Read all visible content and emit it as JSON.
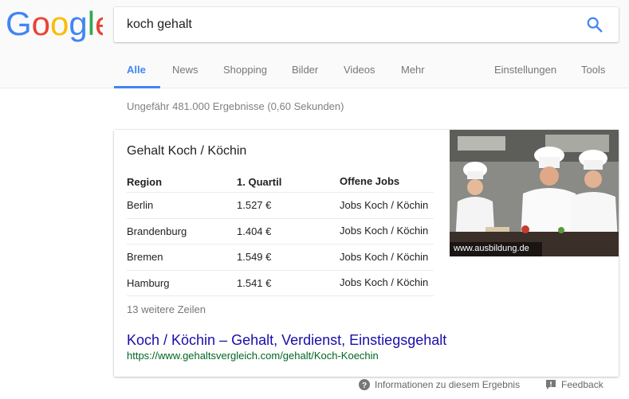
{
  "search": {
    "query": "koch gehalt"
  },
  "tabs": {
    "items": [
      {
        "label": "Alle",
        "active": true
      },
      {
        "label": "News"
      },
      {
        "label": "Shopping"
      },
      {
        "label": "Bilder"
      },
      {
        "label": "Videos"
      },
      {
        "label": "Mehr"
      }
    ],
    "settings": "Einstellungen",
    "tools": "Tools"
  },
  "stats": "Ungefähr 481.000 Ergebnisse (0,60 Sekunden)",
  "card": {
    "title": "Gehalt Koch / Köchin",
    "headers": [
      "Region",
      "1. Quartil",
      "Offene Jobs"
    ],
    "rows": [
      {
        "region": "Berlin",
        "quartil": "1.527 €",
        "jobs": "Jobs Koch / Köchin"
      },
      {
        "region": "Brandenburg",
        "quartil": "1.404 €",
        "jobs": "Jobs Koch / Köchin"
      },
      {
        "region": "Bremen",
        "quartil": "1.549 €",
        "jobs": "Jobs Koch / Köchin"
      },
      {
        "region": "Hamburg",
        "quartil": "1.541 €",
        "jobs": "Jobs Koch / Köchin"
      }
    ],
    "more_rows": "13 weitere Zeilen",
    "link_title": "Koch / Köchin – Gehalt, Verdienst, Einstiegsgehalt",
    "link_url": "https://www.gehaltsvergleich.com/gehalt/Koch-Koechin",
    "image_caption": "www.ausbildung.de"
  },
  "footer": {
    "info": "Informationen zu diesem Ergebnis",
    "feedback": "Feedback"
  },
  "colors": {
    "accent": "#4285f4",
    "link": "#1a0dab",
    "url": "#006621"
  }
}
